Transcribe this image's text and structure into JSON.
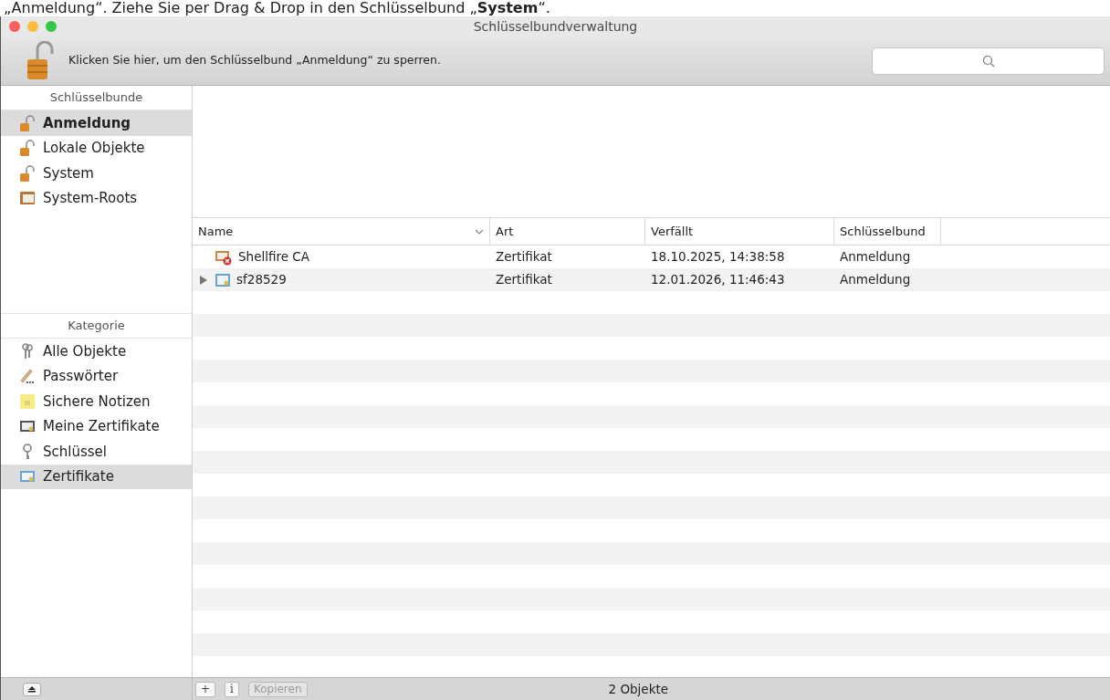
{
  "caption": "„Anmeldung“. Ziehe Sie per Drag & Drop in den Schlüsselbund „**System**“.",
  "window": {
    "title": "Schlüsselbundverwaltung"
  },
  "toolbar": {
    "lock_message": "Klicken Sie hier, um den Schlüsselbund „Anmeldung“ zu sperren."
  },
  "sidebar": {
    "keychains_heading": "Schlüsselbunde",
    "keychains": [
      {
        "label": "Anmeldung",
        "kind": "unlocked",
        "selected": true
      },
      {
        "label": "Lokale Objekte",
        "kind": "unlocked",
        "selected": false
      },
      {
        "label": "System",
        "kind": "unlocked",
        "selected": false
      },
      {
        "label": "System-Roots",
        "kind": "roots",
        "selected": false
      }
    ],
    "category_heading": "Kategorie",
    "categories": [
      {
        "label": "Alle Objekte",
        "kind": "all",
        "selected": false
      },
      {
        "label": "Passwörter",
        "kind": "password",
        "selected": false
      },
      {
        "label": "Sichere Notizen",
        "kind": "note",
        "selected": false
      },
      {
        "label": "Meine Zertifikate",
        "kind": "mycert",
        "selected": false
      },
      {
        "label": "Schlüssel",
        "kind": "key",
        "selected": false
      },
      {
        "label": "Zertifikate",
        "kind": "cert",
        "selected": true
      }
    ]
  },
  "table": {
    "columns": [
      "Name",
      "Art",
      "Verfällt",
      "Schlüsselbund"
    ],
    "rows": [
      {
        "name": "Shellfire CA",
        "kind": "invalid-certificate",
        "has_children": false,
        "type": "Zertifikat",
        "expires": "18.10.2025, 14:38:58",
        "keychain": "Anmeldung"
      },
      {
        "name": "sf28529",
        "kind": "certificate",
        "has_children": true,
        "type": "Zertifikat",
        "expires": "12.01.2026, 11:46:43",
        "keychain": "Anmeldung"
      }
    ]
  },
  "bottom_bar": {
    "buttons": [
      {
        "label": "+",
        "disabled": false
      },
      {
        "label": "i",
        "disabled": false
      },
      {
        "label": "Kopieren",
        "disabled": true
      }
    ],
    "status": "2 Objekte"
  }
}
